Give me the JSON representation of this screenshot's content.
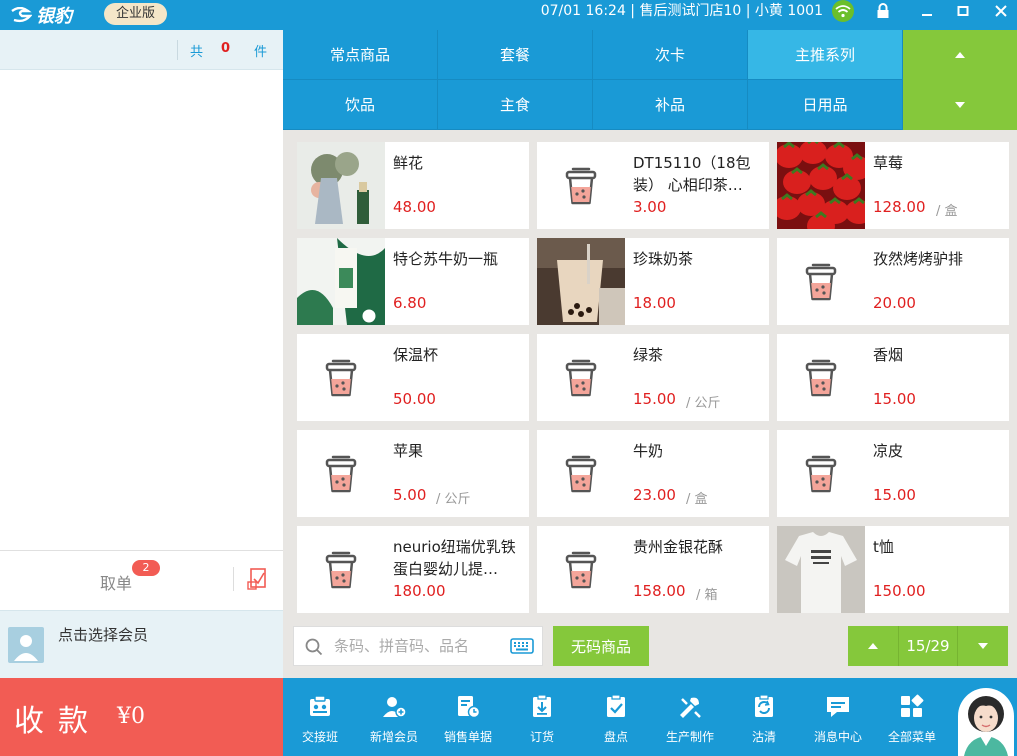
{
  "topbar": {
    "brand": "银豹",
    "edition": "企业版",
    "status": "07/01 16:24 | 售后测试门店10 | 小黄 1001"
  },
  "order": {
    "total_prefix": "共",
    "count": "0",
    "unit": "件",
    "pickup_label": "取单",
    "pickup_badge": "2",
    "member_prompt": "点击选择会员",
    "checkout_label": "收款",
    "checkout_amount": "¥0"
  },
  "categories": {
    "row1": [
      "常点商品",
      "套餐",
      "次卡",
      "主推系列"
    ],
    "row2": [
      "饮品",
      "主食",
      "补品",
      "日用品"
    ],
    "active": "主推系列"
  },
  "products": [
    {
      "name": "鲜花",
      "price": "48.00",
      "unit": "",
      "thumb": "flower-photo"
    },
    {
      "name": "DT15110（18包装） 心相印茶…",
      "price": "3.00",
      "unit": "",
      "thumb": "cup-icon"
    },
    {
      "name": "草莓",
      "price": "128.00",
      "unit": "/ 盒",
      "thumb": "strawberry-photo"
    },
    {
      "name": "特仑苏牛奶一瓶",
      "price": "6.80",
      "unit": "",
      "thumb": "milk-photo"
    },
    {
      "name": "珍珠奶茶",
      "price": "18.00",
      "unit": "",
      "thumb": "bubbletea-photo"
    },
    {
      "name": "孜然烤烤驴排",
      "price": "20.00",
      "unit": "",
      "thumb": "cup-icon"
    },
    {
      "name": "保温杯",
      "price": "50.00",
      "unit": "",
      "thumb": "cup-icon"
    },
    {
      "name": "绿茶",
      "price": "15.00",
      "unit": "/ 公斤",
      "thumb": "cup-icon"
    },
    {
      "name": "香烟",
      "price": "15.00",
      "unit": "",
      "thumb": "cup-icon"
    },
    {
      "name": "苹果",
      "price": "5.00",
      "unit": "/ 公斤",
      "thumb": "cup-icon"
    },
    {
      "name": "牛奶",
      "price": "23.00",
      "unit": "/ 盒",
      "thumb": "cup-icon"
    },
    {
      "name": "凉皮",
      "price": "15.00",
      "unit": "",
      "thumb": "cup-icon"
    },
    {
      "name": "neurio纽瑞优乳铁蛋白婴幼儿提…",
      "price": "180.00",
      "unit": "",
      "thumb": "cup-icon"
    },
    {
      "name": "贵州金银花酥",
      "price": "158.00",
      "unit": "/ 箱",
      "thumb": "cup-icon"
    },
    {
      "name": "t恤",
      "price": "150.00",
      "unit": "",
      "thumb": "tshirt-photo"
    }
  ],
  "search": {
    "placeholder": "条码、拼音码、品名",
    "barcode_button": "无码商品",
    "page": "15/29"
  },
  "toolbar": [
    {
      "label": "交接班",
      "icon": "handover-icon"
    },
    {
      "label": "新增会员",
      "icon": "add-member-icon"
    },
    {
      "label": "销售单据",
      "icon": "sales-doc-icon"
    },
    {
      "label": "订货",
      "icon": "order-goods-icon"
    },
    {
      "label": "盘点",
      "icon": "stocktake-icon"
    },
    {
      "label": "生产制作",
      "icon": "production-icon"
    },
    {
      "label": "沽清",
      "icon": "soldout-icon"
    },
    {
      "label": "消息中心",
      "icon": "message-icon"
    },
    {
      "label": "全部菜单",
      "icon": "menu-grid-icon"
    }
  ],
  "colors": {
    "primary": "#1a9ad6",
    "active_tab": "#36b7e6",
    "accent_green": "#85c83b",
    "checkout_red": "#f25c54",
    "price_red": "#e02020"
  }
}
